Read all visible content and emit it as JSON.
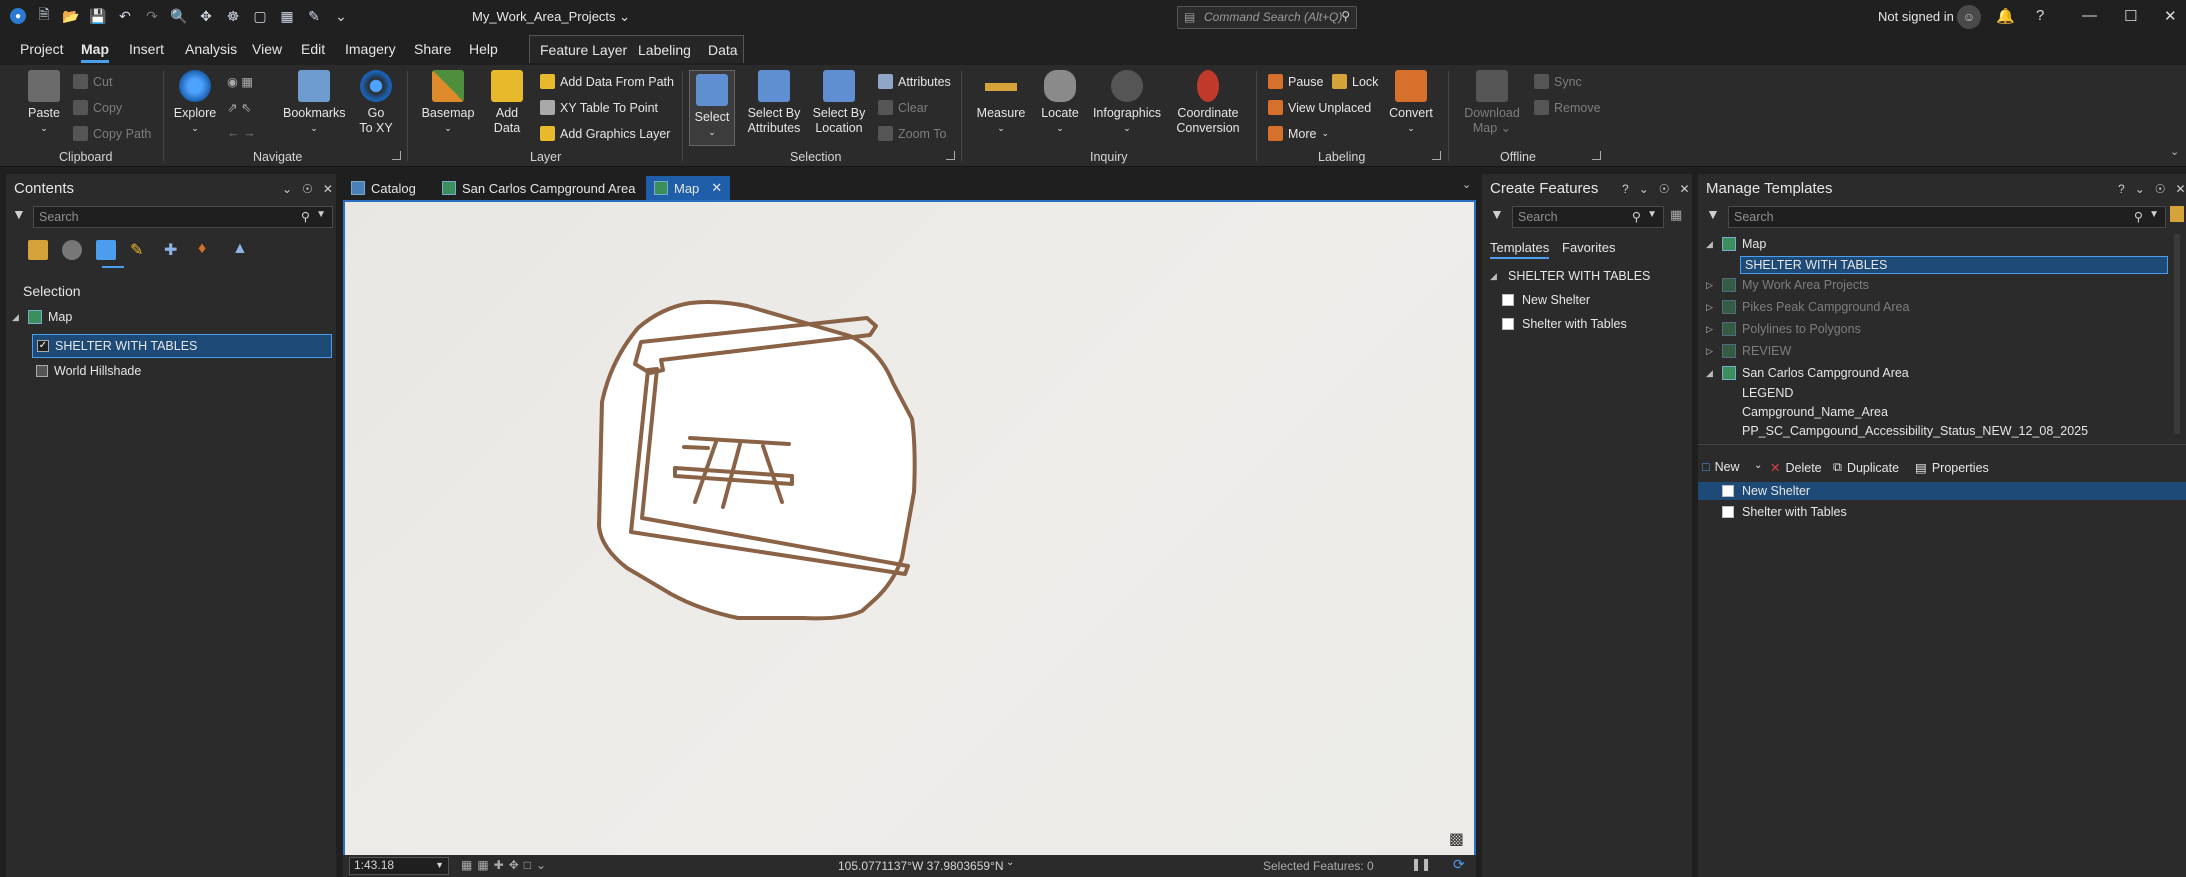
{
  "titlebar": {
    "project_title": "My_Work_Area_Projects ⌄",
    "command_search_placeholder": "Command Search (Alt+Q)",
    "signin": "Not signed in"
  },
  "ribbon_tabs": {
    "items": [
      "Project",
      "Map",
      "Insert",
      "Analysis",
      "View",
      "Edit",
      "Imagery",
      "Share",
      "Help"
    ],
    "active": "Map",
    "contextual": [
      "Feature Layer",
      "Labeling",
      "Data"
    ]
  },
  "ribbon": {
    "clipboard": {
      "label": "Clipboard",
      "paste": "Paste",
      "cut": "Cut",
      "copy": "Copy",
      "copy_path": "Copy Path"
    },
    "navigate": {
      "label": "Navigate",
      "explore": "Explore",
      "bookmarks": "Bookmarks",
      "goto_xy_1": "Go",
      "goto_xy_2": "To XY"
    },
    "layer": {
      "label": "Layer",
      "basemap": "Basemap",
      "add_data_1": "Add",
      "add_data_2": "Data",
      "add_from_path": "Add Data From Path",
      "xy_table": "XY Table To Point",
      "add_graphics": "Add Graphics Layer"
    },
    "selection": {
      "label": "Selection",
      "select": "Select",
      "by_attr_1": "Select By",
      "by_attr_2": "Attributes",
      "by_loc_1": "Select By",
      "by_loc_2": "Location",
      "attributes": "Attributes",
      "clear": "Clear",
      "zoom_to": "Zoom To"
    },
    "inquiry": {
      "label": "Inquiry",
      "measure": "Measure",
      "locate": "Locate",
      "infographics": "Infographics",
      "coord_1": "Coordinate",
      "coord_2": "Conversion"
    },
    "labeling": {
      "label": "Labeling",
      "pause": "Pause",
      "lock": "Lock",
      "view_unplaced": "View Unplaced",
      "more": "More",
      "convert": "Convert"
    },
    "offline": {
      "label": "Offline",
      "download_1": "Download",
      "download_2": "Map",
      "sync": "Sync",
      "remove": "Remove"
    }
  },
  "contents": {
    "title": "Contents",
    "search_placeholder": "Search",
    "section": "Selection",
    "map": "Map",
    "layers": [
      {
        "name": "SHELTER WITH TABLES",
        "checked": true,
        "selected": true
      },
      {
        "name": "World Hillshade",
        "checked": false,
        "selected": false
      }
    ]
  },
  "view_tabs": [
    {
      "label": "Catalog",
      "active": false
    },
    {
      "label": "San Carlos Campground Area",
      "active": false
    },
    {
      "label": "Map",
      "active": true
    }
  ],
  "statusbar": {
    "scale": "1:43.18",
    "coords": "105.0771137°W 37.9803659°N",
    "selected": "Selected Features: 0"
  },
  "create_features": {
    "title": "Create Features",
    "search_placeholder": "Search",
    "tabs": [
      "Templates",
      "Favorites"
    ],
    "group": "SHELTER WITH TABLES",
    "items": [
      "New Shelter",
      "Shelter with Tables"
    ]
  },
  "manage_templates": {
    "title": "Manage Templates",
    "search_placeholder": "Search",
    "tree": [
      {
        "label": "Map",
        "level": 0,
        "expanded": true,
        "dim": false,
        "map": true
      },
      {
        "label": "SHELTER WITH TABLES",
        "level": 1,
        "selected": true,
        "dim": false,
        "map": false
      },
      {
        "label": "My Work Area Projects",
        "level": 0,
        "dim": true,
        "map": true
      },
      {
        "label": "Pikes Peak Campground Area",
        "level": 0,
        "dim": true,
        "map": true
      },
      {
        "label": "Polylines to Polygons",
        "level": 0,
        "dim": true,
        "map": true
      },
      {
        "label": "REVIEW",
        "level": 0,
        "dim": true,
        "map": true
      },
      {
        "label": "San Carlos Campground Area",
        "level": 0,
        "expanded": true,
        "dim": false,
        "map": true
      },
      {
        "label": "LEGEND",
        "level": 1,
        "dim": false,
        "map": false
      },
      {
        "label": "Campground_Name_Area",
        "level": 1,
        "dim": false,
        "map": false
      },
      {
        "label": "PP_SC_Campgound_Accessibility_Status_NEW_12_08_2025",
        "level": 1,
        "dim": false,
        "map": false
      }
    ],
    "toolbar": {
      "new": "New",
      "delete": "Delete",
      "duplicate": "Duplicate",
      "properties": "Properties"
    },
    "templates": [
      "New Shelter",
      "Shelter with Tables"
    ]
  },
  "colors": {
    "accent": "#4a9eed",
    "symbol_stroke": "#8a6246",
    "selection": "#1e4a77"
  }
}
